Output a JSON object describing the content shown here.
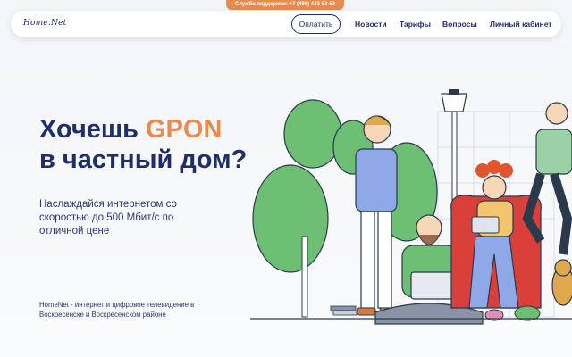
{
  "support": {
    "text": "Служба поддержки: +7 (496) 442-53-53"
  },
  "nav": {
    "logo": "Home.Net",
    "pay_label": "Оплатить",
    "links": [
      "Новости",
      "Тарифы",
      "Вопросы",
      "Личный кабинет"
    ]
  },
  "hero": {
    "title_part1": "Хочешь ",
    "title_accent": "GPON",
    "title_line2": "в частный дом?",
    "subtitle": "Наслаждайся интернетом со скоростью до 500 Мбит/с по отличной цене",
    "footnote": "HomeNet - интернет и цифровое телевидение в Воскресенске и Воскресенском районе"
  },
  "colors": {
    "primary": "#1f2d6b",
    "accent": "#e98a4f",
    "tree": "#6dbf73",
    "shirt_blue": "#8fa8e8",
    "shirt_green": "#6dbf73",
    "chair_red": "#d9403a"
  }
}
